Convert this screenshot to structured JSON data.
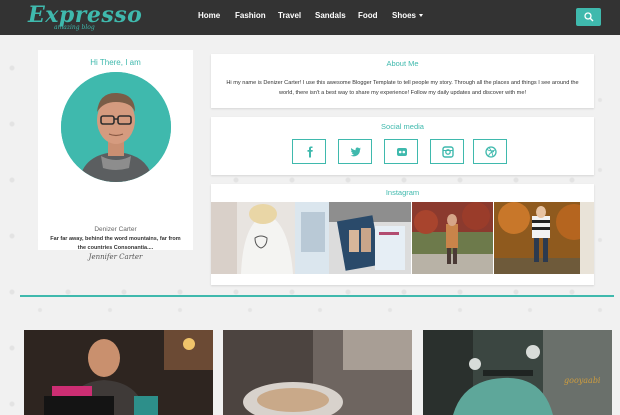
{
  "brand": {
    "logo": "Expresso",
    "tagline": "amazing blog"
  },
  "nav": {
    "items": [
      "Home",
      "Fashion",
      "Travel",
      "Sandals",
      "Food",
      "Shoes"
    ]
  },
  "profile": {
    "heading": "Hi There, I am",
    "name": "Denizer Carter",
    "quote": "Far far away, behind the word mountains, far from the countries Consonantia....",
    "signature": "Jennifer Carter"
  },
  "about": {
    "title": "About Me",
    "text": "Hi my name is Denizer Carter! I use this awesome Blogger Template to tell people my story. Through all the places and things I see around the world, there isn't a best way to share my experience! Follow my daily updates and discover with me!"
  },
  "social": {
    "title": "Social media",
    "icons": [
      "facebook-icon",
      "twitter-icon",
      "flickr-icon",
      "instagram-icon",
      "dribbble-icon"
    ]
  },
  "instagram": {
    "title": "Instagram"
  },
  "watermark": "gooyaabi",
  "colors": {
    "accent": "#3fb9ad",
    "header": "#333333"
  }
}
